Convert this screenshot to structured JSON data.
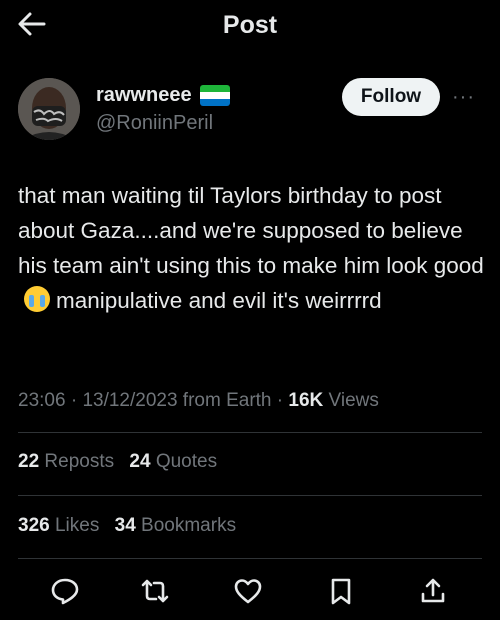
{
  "header": {
    "title": "Post",
    "back_icon": "arrow-left-icon"
  },
  "author": {
    "display_name": "rawwneee",
    "flag_icon": "sierra-leone-flag-icon",
    "handle": "@RoniinPeril",
    "follow_label": "Follow",
    "more_label": "···"
  },
  "post": {
    "text_part1": "that man waiting til Taylors birthday to post about Gaza....and we're supposed to believe his team ain't using this to make him look good",
    "emoji_icon": "loudly-crying-face-emoji",
    "text_part2": "manipulative and evil it's weirrrrd"
  },
  "meta": {
    "time": "23:06",
    "sep1": " · ",
    "date": "13/12/2023",
    "source": " from Earth",
    "sep2": " · ",
    "views_count": "16K",
    "views_label": " Views"
  },
  "stats": {
    "reposts_count": "22",
    "reposts_label": " Reposts",
    "quotes_count": "24",
    "quotes_label": " Quotes",
    "likes_count": "326",
    "likes_label": " Likes",
    "bookmarks_count": "34",
    "bookmarks_label": " Bookmarks"
  },
  "actions": [
    "reply-icon",
    "repost-icon",
    "like-icon",
    "bookmark-icon",
    "share-icon"
  ],
  "colors": {
    "background": "#000000",
    "text": "#e7e9ea",
    "secondary_text": "#71767b",
    "divider": "#2f3336",
    "follow_bg": "#eff3f4",
    "flag_green": "#1eb53a",
    "flag_white": "#ffffff",
    "flag_blue": "#0072c6"
  }
}
